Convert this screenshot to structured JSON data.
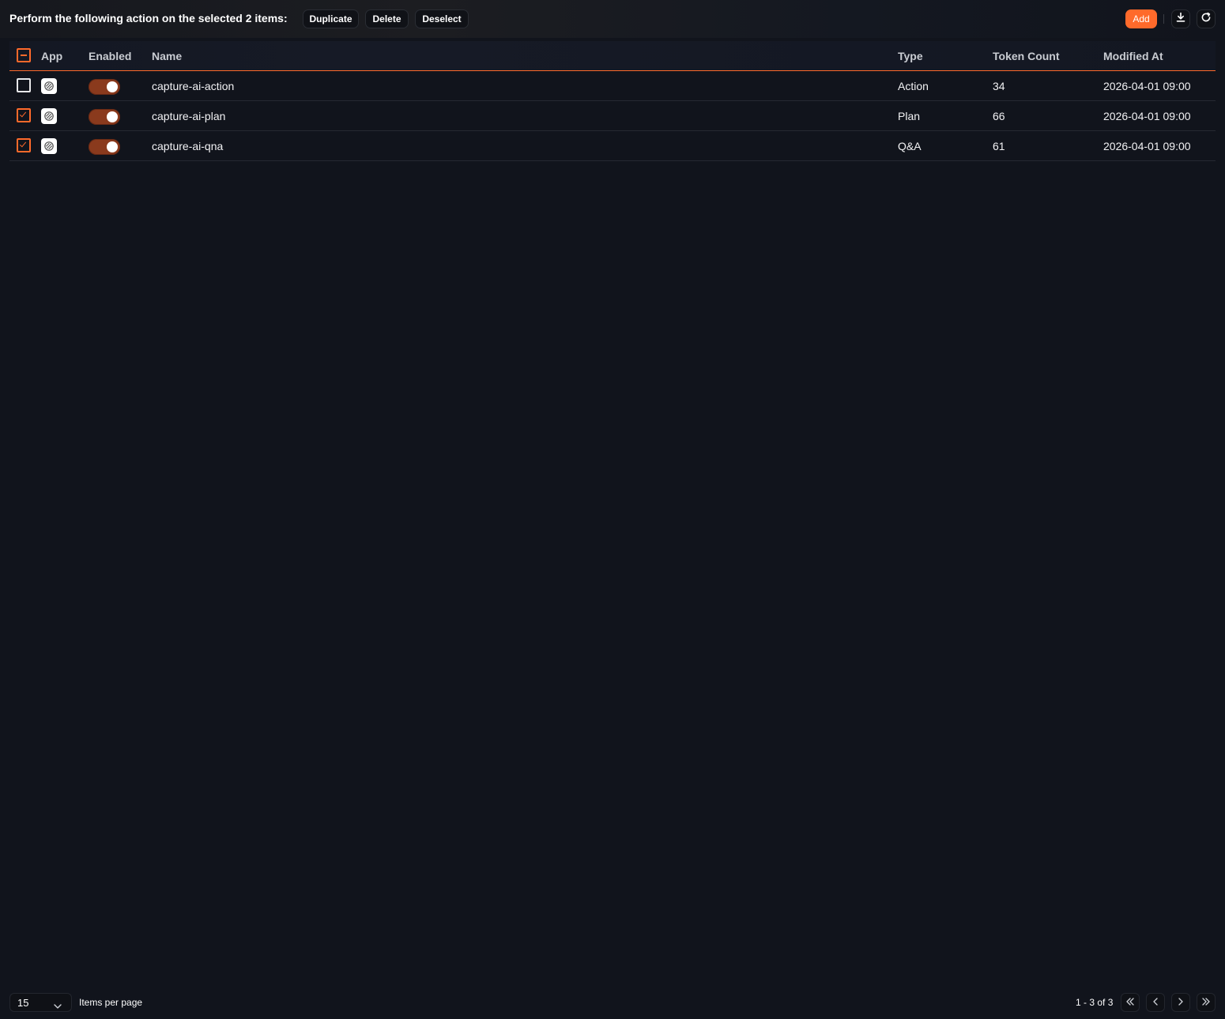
{
  "toolbar": {
    "bulk_message": "Perform the following action on the selected 2 items:",
    "duplicate_label": "Duplicate",
    "delete_label": "Delete",
    "deselect_label": "Deselect",
    "add_label": "Add",
    "download_icon": "download-icon",
    "refresh_icon": "refresh-icon"
  },
  "table": {
    "columns": [
      "App",
      "Enabled",
      "Name",
      "Type",
      "Token Count",
      "Modified At"
    ],
    "header_checkbox_state": "indeterminate",
    "rows": [
      {
        "selected": false,
        "enabled": true,
        "name": "capture-ai-action",
        "type": "Action",
        "token_count": "34",
        "modified_at": "2026-04-01 09:00"
      },
      {
        "selected": true,
        "enabled": true,
        "name": "capture-ai-plan",
        "type": "Plan",
        "token_count": "66",
        "modified_at": "2026-04-01 09:00"
      },
      {
        "selected": true,
        "enabled": true,
        "name": "capture-ai-qna",
        "type": "Q&A",
        "token_count": "61",
        "modified_at": "2026-04-01 09:00"
      }
    ]
  },
  "footer": {
    "per_page_value": "15",
    "per_page_label": "Items per page",
    "range_text": "1 - 3 of 3"
  },
  "colors": {
    "accent": "#ff6a2b",
    "background": "#11141c",
    "toggle_on": "#8a3a1d"
  }
}
